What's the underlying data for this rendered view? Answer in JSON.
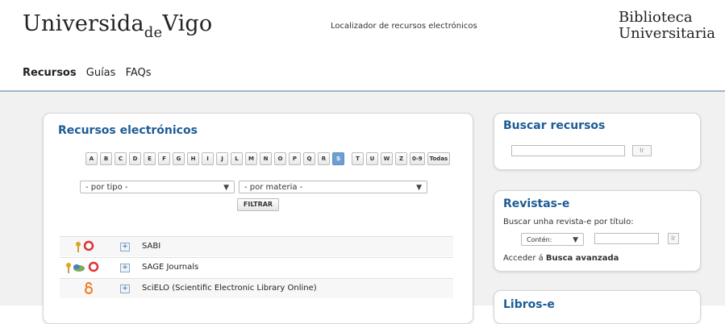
{
  "header": {
    "logo_main": "Universida",
    "logo_sub": "de",
    "logo_end": "Vigo",
    "locator": "Localizador de recursos electrónicos",
    "library_line1": "Biblioteca",
    "library_line2": "Universitaria"
  },
  "nav": {
    "items": [
      "Recursos",
      "Guías",
      "FAQs"
    ]
  },
  "recursos": {
    "title": "Recursos electrónicos",
    "letters": [
      "A",
      "B",
      "C",
      "D",
      "E",
      "F",
      "G",
      "H",
      "I",
      "J",
      "L",
      "M",
      "N",
      "O",
      "P",
      "Q",
      "R",
      "S",
      "T",
      "U",
      "W",
      "Z",
      "0-9",
      "Todas"
    ],
    "selected_letter": "S",
    "type_select": "- por tipo -",
    "subject_select": "- por materia -",
    "filter_label": "FILTRAR",
    "rows": [
      {
        "name": "SABI"
      },
      {
        "name": "SAGE Journals"
      },
      {
        "name": "SciELO (Scientific Electronic Library Online)"
      }
    ]
  },
  "buscar": {
    "title": "Buscar recursos",
    "button": "Ir"
  },
  "revistas": {
    "title": "Revistas-e",
    "prompt": "Buscar unha revista-e por título:",
    "mode": "Contén:",
    "button": "Ir",
    "advanced_prefix": "Acceder á ",
    "advanced_link": "Busca avanzada"
  },
  "libros": {
    "title": "Libros-e"
  },
  "colors": {
    "accent": "#1d5c95",
    "selected_letter": "#6f9fd1"
  }
}
